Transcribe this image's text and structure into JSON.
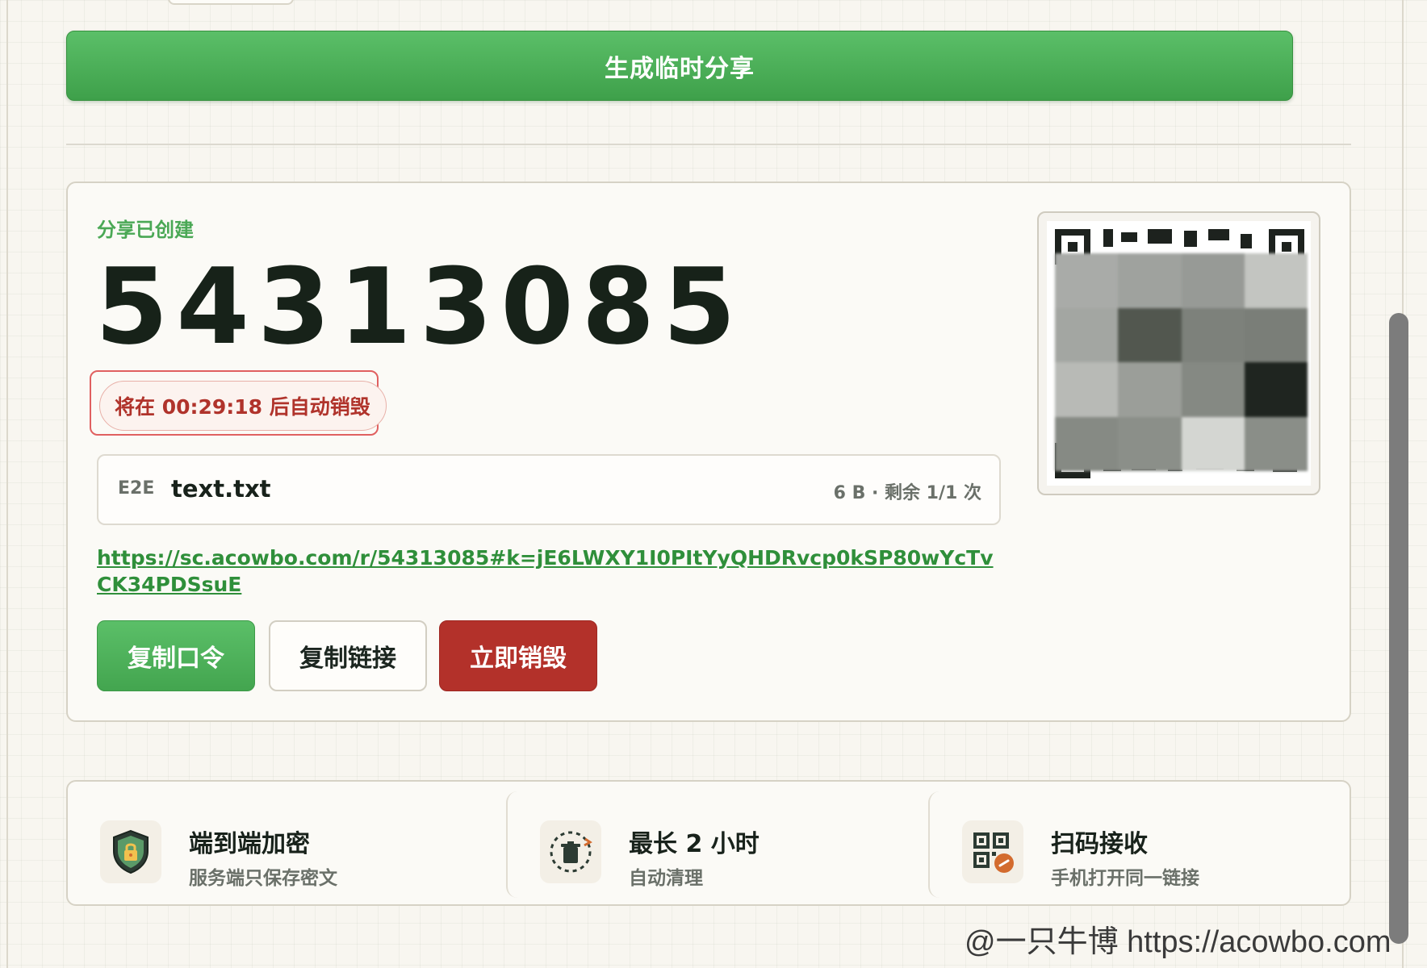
{
  "generate_button_label": "生成临时分享",
  "share": {
    "status_label": "分享已创建",
    "code": "54313085",
    "countdown_text": "将在 00:29:18 后自动销毁",
    "file": {
      "encryption_tag": "E2E",
      "name": "text.txt",
      "meta": "6 B · 剩余 1/1 次"
    },
    "link": "https://sc.acowbo.com/r/54313085#k=jE6LWXY1I0PItYyQHDRvcp0kSP80wYcTvCK34PDSsuE",
    "buttons": {
      "copy_code": "复制口令",
      "copy_link": "复制链接",
      "destroy": "立即销毁"
    }
  },
  "features": [
    {
      "icon": "shield-lock-icon",
      "title": "端到端加密",
      "subtitle": "服务端只保存密文"
    },
    {
      "icon": "trash-timer-icon",
      "title": "最长 2 小时",
      "subtitle": "自动清理"
    },
    {
      "icon": "qr-link-icon",
      "title": "扫码接收",
      "subtitle": "手机打开同一链接"
    }
  ],
  "watermark": "@一只牛博 https://acowbo.com",
  "colors": {
    "primary_green": "#4caf50",
    "danger_red": "#b3312a",
    "link_green": "#2f8f3a",
    "countdown_red": "#b0332b"
  }
}
